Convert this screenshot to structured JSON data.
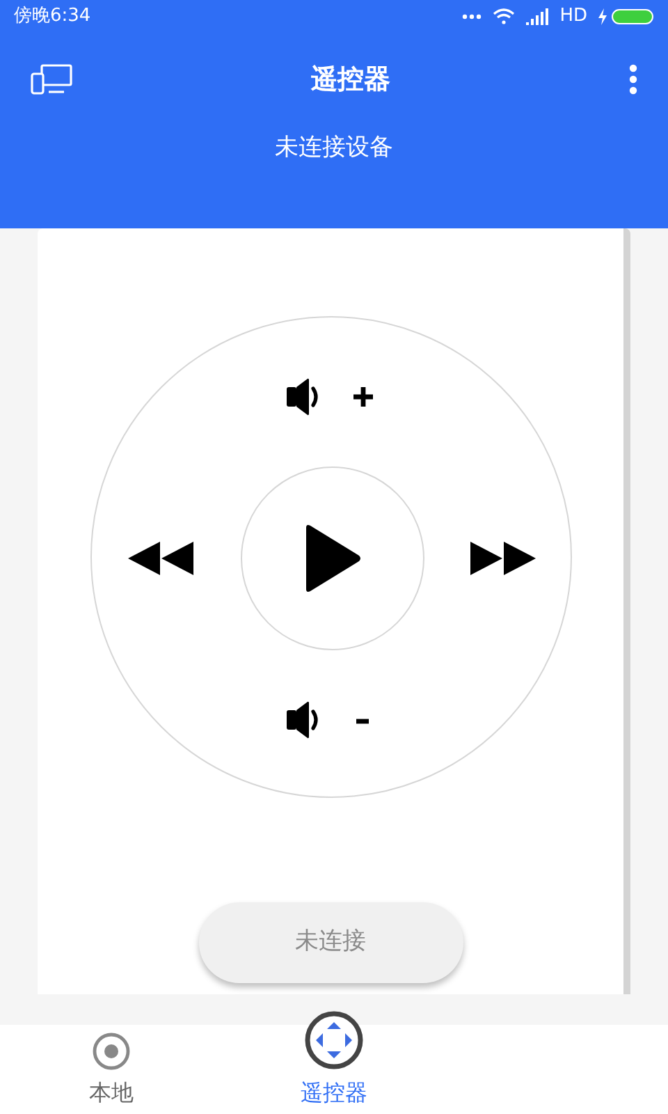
{
  "status_bar": {
    "time": "傍晚6:34",
    "network": "HD"
  },
  "app_bar": {
    "title": "遥控器"
  },
  "connection_status": "未连接设备",
  "connect_button": {
    "label": "未连接",
    "disabled": true
  },
  "bottom_nav": [
    {
      "label": "本地",
      "selected": false
    },
    {
      "label": "遥控器",
      "selected": true
    }
  ]
}
